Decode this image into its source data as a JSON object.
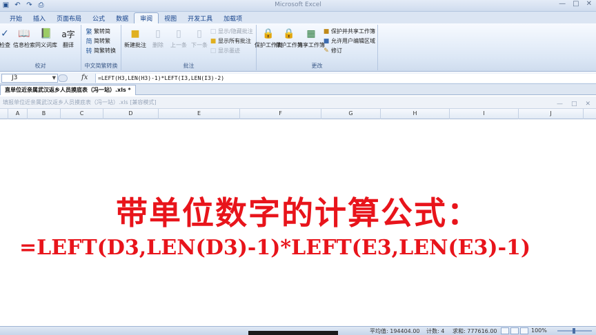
{
  "window": {
    "title": "Microsoft Excel"
  },
  "qat": {
    "icons": [
      "save-icon",
      "undo-icon",
      "redo-icon",
      "print-preview-icon"
    ]
  },
  "tabs": [
    "开始",
    "插入",
    "页面布局",
    "公式",
    "数据",
    "审阅",
    "视图",
    "开发工具",
    "加载项"
  ],
  "active_tab": "审阅",
  "ribbon": {
    "proofing": {
      "label": "校对",
      "buttons": [
        "检查",
        "信息检索",
        "同义词库",
        "翻译"
      ]
    },
    "chinese_conversion": {
      "label": "中文简繁转换",
      "buttons": [
        "繁转简",
        "简转繁",
        "简繁转换"
      ]
    },
    "comments": {
      "label": "批注",
      "buttons": [
        "新建批注",
        "删除",
        "上一条",
        "下一条"
      ],
      "small": [
        "显示/隐藏批注",
        "显示所有批注",
        "显示墨迹"
      ]
    },
    "changes": {
      "label": "更改",
      "buttons": [
        "保护工作表",
        "保护工作簿",
        "共享工作簿"
      ],
      "small": [
        "保护并共享工作簿",
        "允许用户编辑区域",
        "修订"
      ]
    }
  },
  "formula_bar": {
    "name_box": "J3",
    "fx": "fx",
    "formula": "=LEFT(H3,LEN(H3)-1)*LEFT(I3,LEN(I3)-2)"
  },
  "workbook": {
    "tab_label": "直单位近亲属武汉返乡人员摸底表（冯一站）.xls *",
    "window_title": "填报单位近亲属武汉返乡人员摸底表（冯一站）.xls [兼容模式]"
  },
  "columns": [
    "A",
    "B",
    "C",
    "D",
    "E",
    "F",
    "G",
    "H",
    "I",
    "J"
  ],
  "content": {
    "line1": "带单位数字的计算公式：",
    "line2": "=LEFT(D3,LEN(D3)-1)*LEFT(E3,LEN(E3)-1)"
  },
  "status": {
    "average": "平均值: 194404.00",
    "count": "计数: 4",
    "sum": "求和: 777616.00",
    "zoom": "100%"
  },
  "colors": {
    "accent_text": "#e8141b",
    "ribbon_blue": "#15428b"
  }
}
